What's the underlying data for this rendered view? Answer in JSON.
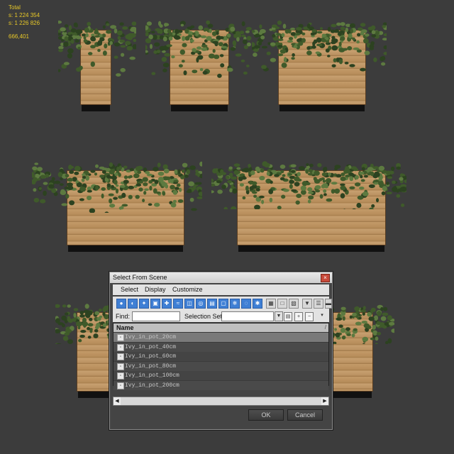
{
  "stats": {
    "title": "Total",
    "polys_label": "s:",
    "polys_value": "1 224 354",
    "verts_label": "s:",
    "verts_value": "1 226 826",
    "fps": "666,401"
  },
  "dialog": {
    "title": "Select From Scene",
    "close_glyph": "×",
    "menu": [
      "Select",
      "Display",
      "Customize"
    ],
    "find_label": "Find:",
    "find_value": "",
    "selection_set_label": "Selection Set:",
    "selection_set_value": "",
    "column_header": "Name",
    "sort_glyph": "/",
    "items": [
      "Ivy_in_pot_20cm",
      "Ivy_in_pot_40cm",
      "Ivy_in_pot_60cm",
      "Ivy_in_pot_80cm",
      "Ivy_in_pot_100cm",
      "Ivy_in_pot_200cm"
    ],
    "ok_label": "OK",
    "cancel_label": "Cancel",
    "scroll_left": "◀",
    "scroll_right": "▶"
  },
  "colors": {
    "viewport_bg": "#3c3c3c",
    "stats_text": "#e8c828",
    "ivy_leaf": "#3f5a2a",
    "wood": "#b88e5c",
    "toolbar_icon": "#3f7fd4"
  }
}
